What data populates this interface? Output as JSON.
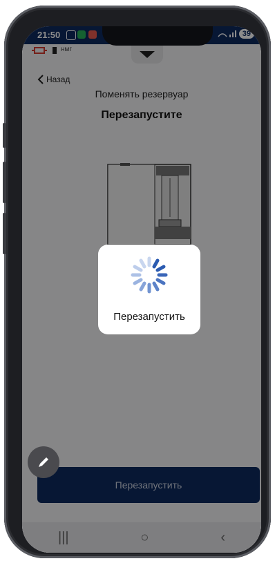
{
  "status": {
    "time": "21:50",
    "battery": "39"
  },
  "app": {
    "unit": "нмг"
  },
  "nav": {
    "back_label": "Назад"
  },
  "header": {
    "subtitle": "Поменять резервуар",
    "title": "Перезапустите"
  },
  "main_button": {
    "label": "Перезапустить"
  },
  "modal": {
    "label": "Перезапустить"
  },
  "colors": {
    "primary": "#0e2a60",
    "overlay": "rgba(0,0,0,0.45)"
  },
  "icons": [
    "chevron-left-icon",
    "spinner-icon",
    "pencil-icon",
    "recent-apps-icon",
    "home-icon",
    "back-icon"
  ]
}
